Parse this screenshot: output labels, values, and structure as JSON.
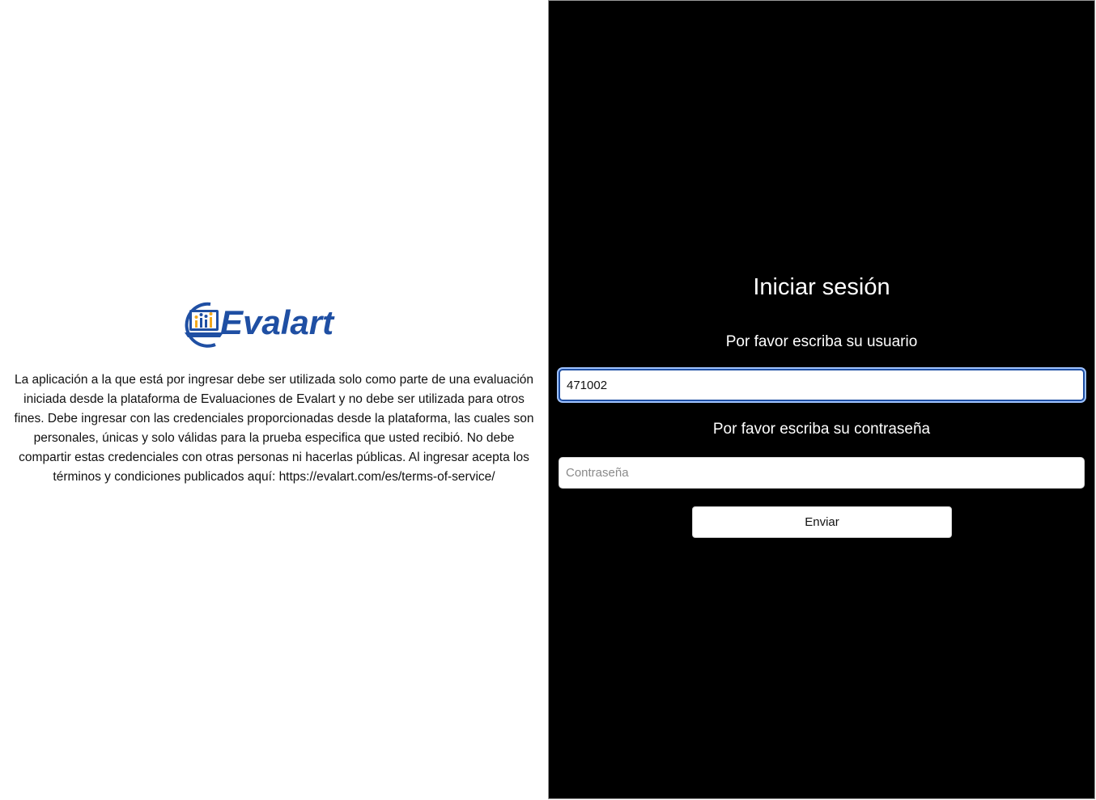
{
  "brand": {
    "name": "Evalart",
    "primary_color": "#1f4fa3",
    "accent_color": "#f2a81d"
  },
  "disclaimer": {
    "text": "La aplicación a la que está por ingresar debe ser utilizada solo como parte de una evaluación iniciada desde la plataforma de Evaluaciones de Evalart y no debe ser utilizada para otros fines. Debe ingresar con las credenciales proporcionadas desde la plataforma, las cuales son personales, únicas y solo válidas para la prueba especifica que usted recibió. No debe compartir estas credenciales con otras personas ni hacerlas públicas. Al ingresar acepta los términos y condiciones publicados aquí: https://evalart.com/es/terms-of-service/"
  },
  "login": {
    "title": "Iniciar sesión",
    "username_label": "Por favor escriba su usuario",
    "username_value": "471002",
    "password_label": "Por favor escriba su contraseña",
    "password_placeholder": "Contraseña",
    "submit_label": "Enviar"
  }
}
